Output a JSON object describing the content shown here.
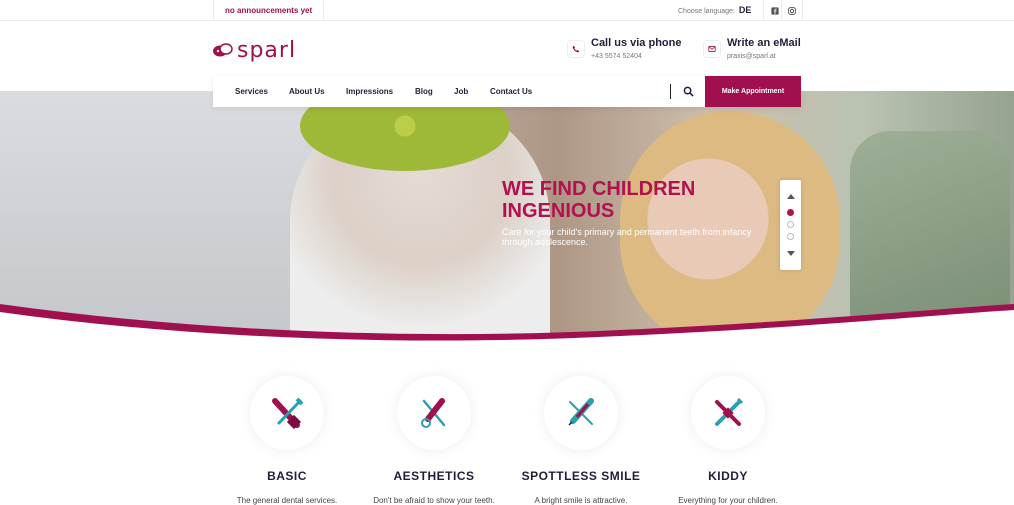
{
  "topbar": {
    "announcement": "no announcements yet",
    "language_label": "Choose language:",
    "language_value": "DE",
    "social": [
      "facebook-icon",
      "instagram-icon"
    ]
  },
  "header": {
    "logo_text": "sparl",
    "phone": {
      "title": "Call us via phone",
      "value": "+43 5574 52404"
    },
    "email": {
      "title": "Write an eMail",
      "value": "praxis@sparl.at"
    }
  },
  "nav": {
    "items": [
      "Services",
      "About Us",
      "Impressions",
      "Blog",
      "Job",
      "Contact Us"
    ],
    "appointment_label": "Make Appointment"
  },
  "hero": {
    "title": "WE FIND CHILDREN INGENIOUS",
    "subtitle": "Care for your child's primary and permanent teeth from infancy through adolescence.",
    "slides": 3,
    "active_slide": 1
  },
  "services": [
    {
      "title": "BASIC",
      "desc": "The general dental services."
    },
    {
      "title": "AESTHETICS",
      "desc": "Don't be afraid to show your teeth."
    },
    {
      "title": "SPOTTLESS SMILE",
      "desc": "A bright smile is attractive."
    },
    {
      "title": "KIDDY",
      "desc": "Everything for your children."
    }
  ],
  "colors": {
    "brand": "#a0104f",
    "teal": "#2a9fb0",
    "dark": "#1f1f3a"
  }
}
